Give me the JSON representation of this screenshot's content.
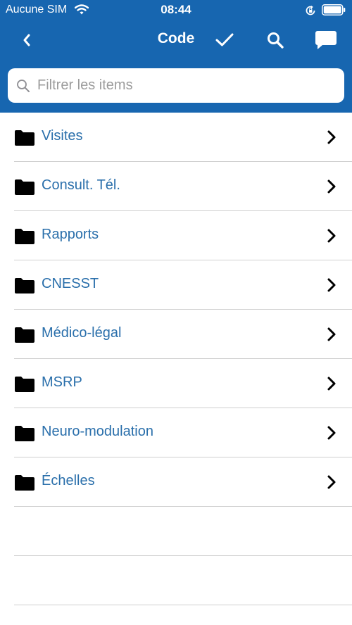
{
  "status_bar": {
    "carrier": "Aucune SIM",
    "time": "08:44"
  },
  "nav": {
    "title": "Code"
  },
  "search": {
    "placeholder": "Filtrer les items"
  },
  "list": {
    "items": [
      {
        "label": "Visites"
      },
      {
        "label": "Consult. Tél."
      },
      {
        "label": "Rapports"
      },
      {
        "label": "CNESST"
      },
      {
        "label": "Médico-légal"
      },
      {
        "label": "MSRP"
      },
      {
        "label": "Neuro-modulation"
      },
      {
        "label": "Échelles"
      }
    ]
  },
  "colors": {
    "header": "#1766b0",
    "item_text": "#2a6fab",
    "separator": "#cfcfcf"
  },
  "icons": [
    "wifi-icon",
    "orientation-lock-icon",
    "battery-icon",
    "back-icon",
    "checkmark-icon",
    "search-icon",
    "comment-icon",
    "folder-icon",
    "chevron-right-icon"
  ]
}
